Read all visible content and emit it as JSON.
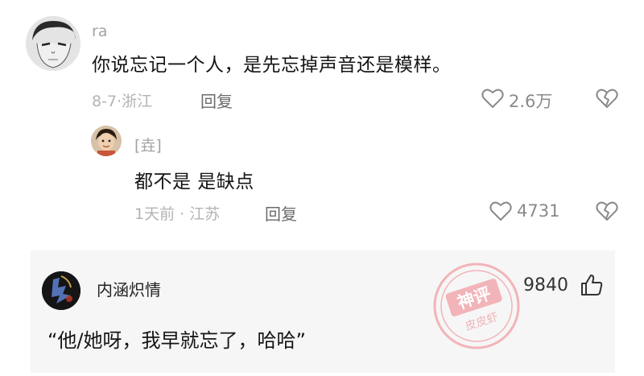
{
  "comments": [
    {
      "username": "ra",
      "text": "你说忘记一个人，是先忘掉声音还是模样。",
      "date": "8-7",
      "location": "浙江",
      "reply_label": "回复",
      "likes": "2.6万"
    },
    {
      "username": "[垚]",
      "text": "都不是  是缺点",
      "date": "1天前",
      "location": "江苏",
      "reply_label": "回复",
      "likes": "4731"
    }
  ],
  "hot_comment": {
    "username": "内涵炽情",
    "likes": "9840",
    "text": "“他/她呀，我早就忘了，哈哈”",
    "stamp_text": [
      "神评",
      "皮皮虾"
    ]
  },
  "colors": {
    "stamp": "#f2b4b8",
    "text_main": "#141414",
    "meta": "#b3b3b3",
    "hot_bg": "#f6f6f6"
  },
  "icons": {
    "like": "heart-outline-icon",
    "dislike": "broken-heart-icon",
    "thumbs_up": "thumbs-up-icon"
  }
}
